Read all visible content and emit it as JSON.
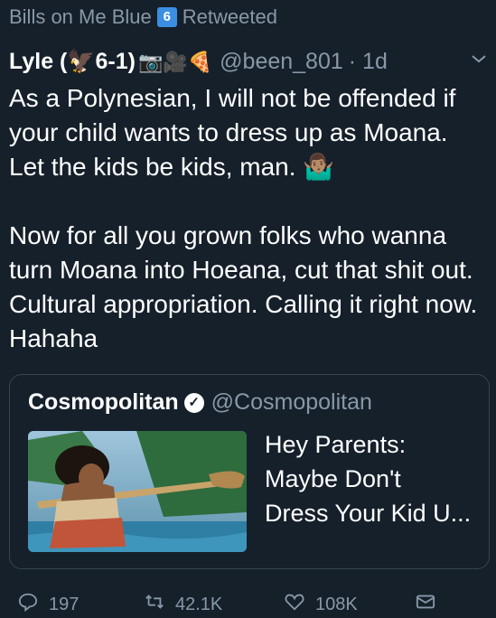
{
  "retweet": {
    "label": "Bills on Me Blue",
    "badge": "6",
    "suffix": "Retweeted"
  },
  "tweet": {
    "name": "Lyle (🦅6-1)",
    "emojis": "📷🎥🍕",
    "handle": "@been_801",
    "time": "· 1d",
    "paragraph1": "As a Polynesian, I will not be offended if your child wants to dress up as Moana. Let the kids be kids, man. 🤷🏽‍♂️",
    "paragraph2": "Now for all you grown folks who wanna turn Moana into Hoeana, cut that shit out. Cultural appropriation. Calling it right now. Hahaha"
  },
  "quote": {
    "name": "Cosmopolitan",
    "handle": "@Cosmopolitan",
    "title_line1": "Hey Parents:",
    "title_line2": "Maybe Don't",
    "title_line3": "Dress Your Kid U..."
  },
  "actions": {
    "replies": "197",
    "retweets": "42.1K",
    "likes": "108K"
  },
  "colors": {
    "background": "#15202b",
    "muted": "#8899a6",
    "border": "#38444d"
  },
  "icons": [
    "chevron-down-icon",
    "verified-icon",
    "reply-icon",
    "retweet-icon",
    "like-icon",
    "dm-icon"
  ]
}
